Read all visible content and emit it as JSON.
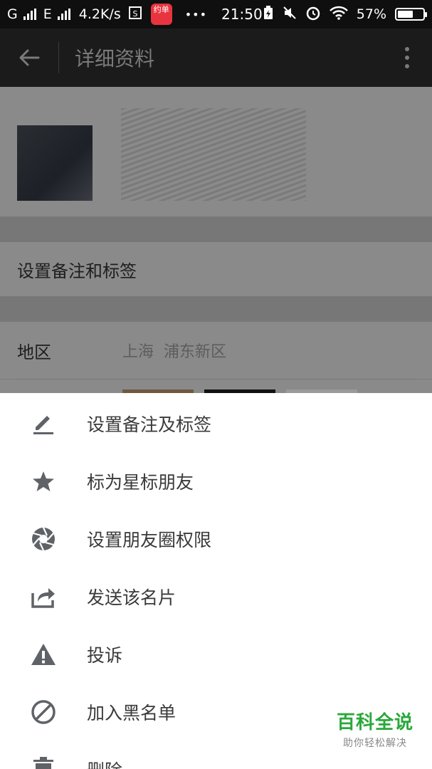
{
  "status_bar": {
    "carrier_1": "G",
    "carrier_2": "E",
    "net_speed": "4.2K/s",
    "app_badge": "约单",
    "time": "21:50",
    "battery": "57%"
  },
  "toolbar": {
    "title": "详细资料"
  },
  "profile": {
    "remark_row": "设置备注和标签",
    "region_label": "地区",
    "region_province": "上海",
    "region_district": "浦东新区"
  },
  "menu": {
    "items": [
      {
        "label": "设置备注及标签",
        "icon": "edit-icon"
      },
      {
        "label": "标为星标朋友",
        "icon": "star-icon"
      },
      {
        "label": "设置朋友圈权限",
        "icon": "aperture-icon"
      },
      {
        "label": "发送该名片",
        "icon": "share-icon"
      },
      {
        "label": "投诉",
        "icon": "warning-icon"
      },
      {
        "label": "加入黑名单",
        "icon": "block-icon"
      },
      {
        "label": "删除",
        "icon": "trash-icon"
      }
    ]
  },
  "watermark": {
    "main": "百科全说",
    "sub": "助你轻松解决"
  },
  "colors": {
    "menu_icon": "#5f6368",
    "watermark_green": "#29a83a",
    "status_bar_bg": "#0f0f0f"
  }
}
